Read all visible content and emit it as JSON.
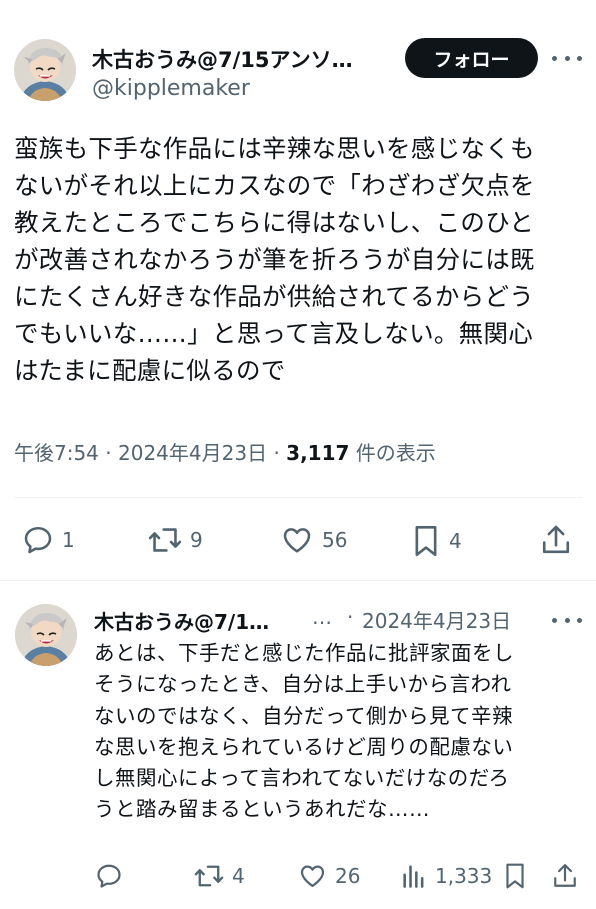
{
  "main_tweet": {
    "display_name": "木古おうみ@7/15アンソ…",
    "handle": "@kipplemaker",
    "follow_label": "フォロー",
    "text_lines": [
      "蛮族も下手な作品には辛辣な思いを感じなくも",
      "ないがそれ以上にカスなので「わざわざ欠点を",
      "教えたところでこちらに得はないし、このひと",
      "が改善されなかろうが筆を折ろうが自分には既",
      "にたくさん好きな作品が供給されてるからどう",
      "でもいいな……」と思って言及しない。無関心",
      "はたまに配慮に似るので"
    ],
    "time": "午後7:54",
    "separator": "·",
    "date": "2024年4月23日",
    "views_count": "3,117",
    "views_label": "件の表示",
    "actions": {
      "replies": "1",
      "retweets": "9",
      "likes": "56",
      "bookmarks": "4"
    }
  },
  "reply_tweet": {
    "display_name": "木古おうみ@7/1…",
    "ellipsis": "…",
    "separator": "·",
    "date": "2024年4月23日",
    "text_lines": [
      "あとは、下手だと感じた作品に批評家面をし",
      "そうになったとき、自分は上手いから言われ",
      "ないのではなく、自分だって側から見て辛辣",
      "な思いを抱えられているけど周りの配慮ない",
      "し無関心によって言われてないだけなのだろ",
      "うと踏み留まるというあれだな……"
    ],
    "actions": {
      "retweets": "4",
      "likes": "26",
      "views": "1,333"
    }
  },
  "colors": {
    "text_primary": "#0f1419",
    "text_secondary": "#536471",
    "divider": "#eff3f4",
    "follow_button_bg": "#0f1419"
  }
}
